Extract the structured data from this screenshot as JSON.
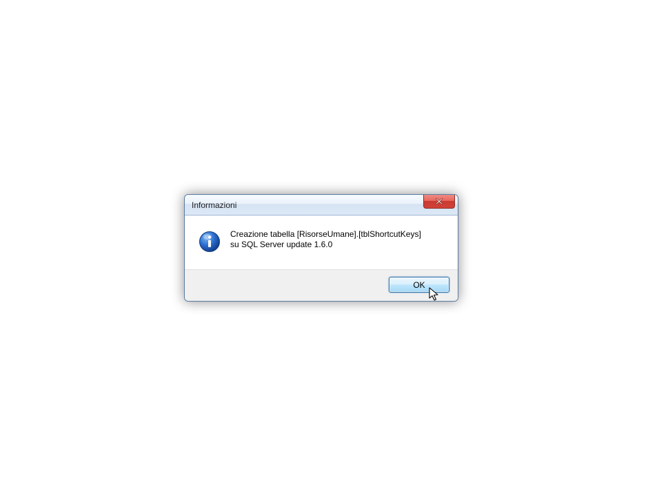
{
  "dialog": {
    "title": "Informazioni",
    "message_line1": "Creazione tabella [RisorseUmane].[tblShortcutKeys]",
    "message_line2": "su SQL Server update 1.6.0",
    "ok_label": "OK"
  }
}
